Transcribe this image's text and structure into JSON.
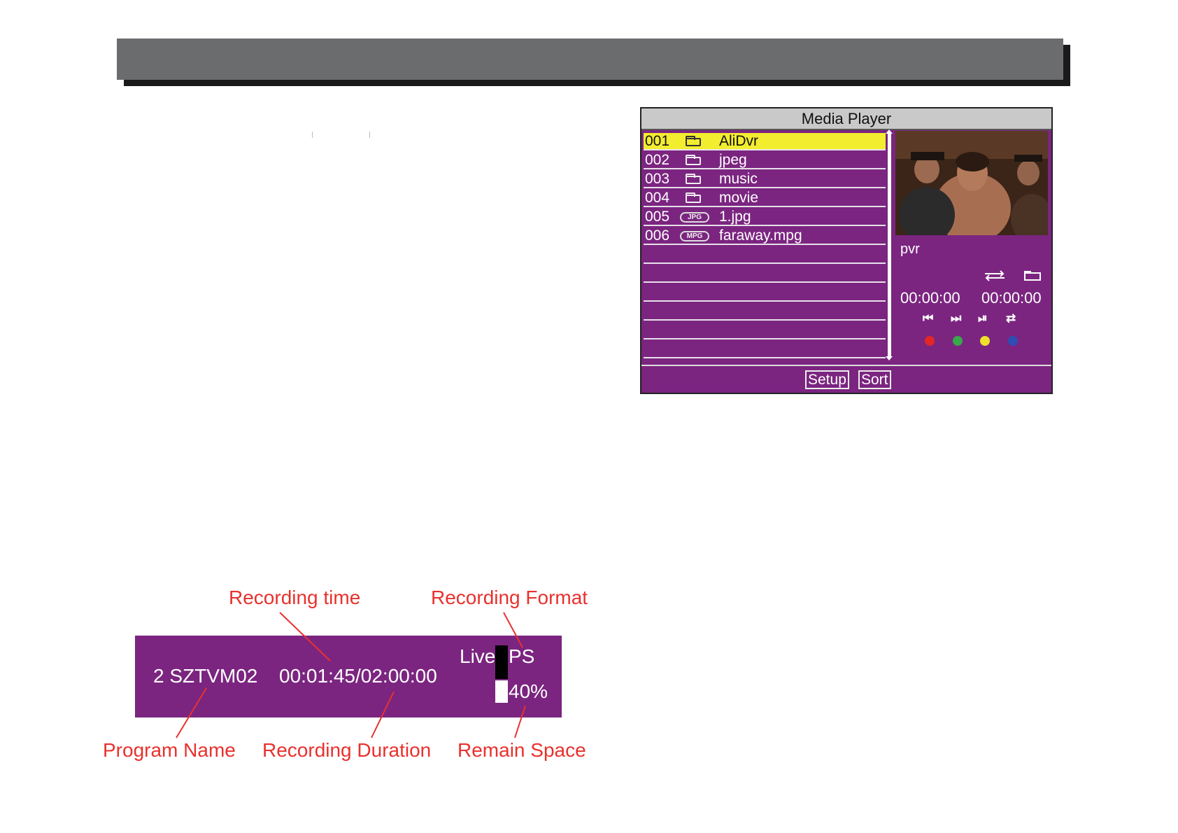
{
  "media_player": {
    "title": "Media Player",
    "files": [
      {
        "num": "001",
        "icon": "folder-icon",
        "name": "AliDvr",
        "selected": true
      },
      {
        "num": "002",
        "icon": "folder-icon",
        "name": "jpeg"
      },
      {
        "num": "003",
        "icon": "folder-icon",
        "name": "music"
      },
      {
        "num": "004",
        "icon": "folder-icon",
        "name": "movie"
      },
      {
        "num": "005",
        "icon": "jpg-file-icon",
        "badge": "JPG",
        "name": "1.jpg"
      },
      {
        "num": "006",
        "icon": "mpg-file-icon",
        "badge": "MPG",
        "name": "faraway.mpg"
      }
    ],
    "preview_label": "pvr",
    "elapsed_time": "00:00:00",
    "total_time": "00:00:00",
    "status_icons": [
      "repeat-icon",
      "folder-icon"
    ],
    "controls": [
      {
        "icon": "previous-icon",
        "glyph": "⏮",
        "color": "#e32626"
      },
      {
        "icon": "next-icon",
        "glyph": "⏭",
        "color": "#38a84a"
      },
      {
        "icon": "play-pause-icon",
        "glyph": "⏯",
        "color": "#efe02a"
      },
      {
        "icon": "return-icon",
        "glyph": "⇄",
        "color": "#2f4db3"
      }
    ],
    "buttons": {
      "setup": "Setup",
      "sort": "Sort"
    }
  },
  "recording_bar": {
    "program_name": "2 SZTVM02",
    "time": "00:01:45/02:00:00",
    "mode": "Live",
    "format": "PS",
    "remain": "40%"
  },
  "annotations": {
    "recording_time": "Recording time",
    "recording_format": "Recording Format",
    "program_name": "Program Name",
    "recording_duration": "Recording Duration",
    "remain_space": "Remain Space"
  }
}
